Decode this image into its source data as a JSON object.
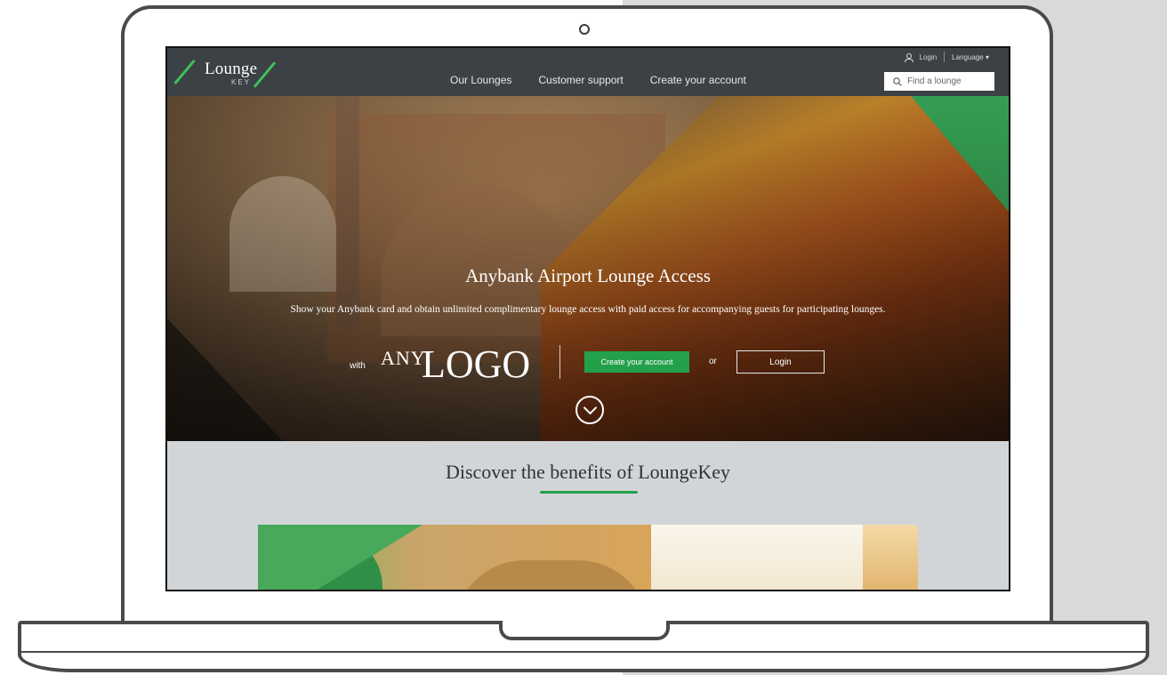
{
  "brand": {
    "logo_word": "Lounge",
    "logo_sub": "KEY",
    "accent_color": "#23a04a"
  },
  "nav": {
    "links": [
      "Our Lounges",
      "Customer support",
      "Create your account"
    ],
    "login_label": "Login",
    "language_label": "Language",
    "search_placeholder": "Find a lounge"
  },
  "hero": {
    "title": "Anybank Airport Lounge Access",
    "subtitle": "Show your Anybank card and obtain unlimited complimentary lounge access with paid access for accompanying guests for participating lounges.",
    "with_label": "with",
    "logo_any": "ANY",
    "logo_logo": "LOGO",
    "create_account_button": "Create your account",
    "or_label": "or",
    "login_button": "Login",
    "scroll_icon": "chevron-down-circle-icon"
  },
  "benefits": {
    "title": "Discover the benefits of LoungeKey"
  }
}
